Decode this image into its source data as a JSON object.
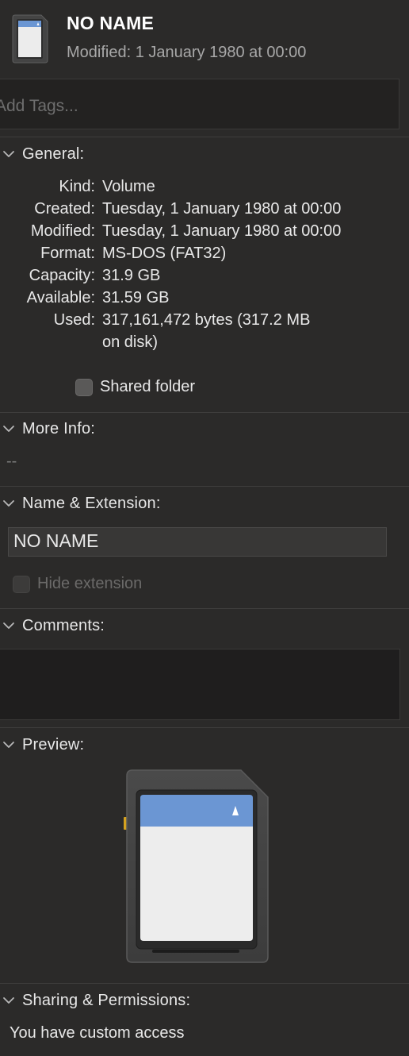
{
  "header": {
    "title": "NO NAME",
    "modified": "Modified: 1 January 1980 at 00:00"
  },
  "tags": {
    "placeholder": "Add Tags..."
  },
  "sections": {
    "general": "General:",
    "more_info": "More Info:",
    "name_extension": "Name & Extension:",
    "comments": "Comments:",
    "preview": "Preview:",
    "sharing": "Sharing & Permissions:"
  },
  "general": {
    "rows": [
      {
        "label": "Kind:",
        "value": "Volume"
      },
      {
        "label": "Created:",
        "value": "Tuesday, 1 January 1980 at 00:00"
      },
      {
        "label": "Modified:",
        "value": "Tuesday, 1 January 1980 at 00:00"
      },
      {
        "label": "Format:",
        "value": "MS-DOS (FAT32)"
      },
      {
        "label": "Capacity:",
        "value": "31.9 GB"
      },
      {
        "label": "Available:",
        "value": "31.59 GB"
      },
      {
        "label": "Used:",
        "value": "317,161,472 bytes (317.2 MB"
      }
    ],
    "used_continuation": "on disk)",
    "shared_folder_label": "Shared folder",
    "shared_folder_checked": false
  },
  "more_info": {
    "value": "--"
  },
  "name_extension": {
    "name_value": "NO NAME",
    "hide_extension_label": "Hide extension",
    "hide_extension_checked": false
  },
  "comments": {
    "value": ""
  },
  "sharing": {
    "access_text": "You have custom access"
  },
  "icons": {
    "volume": "sd-card-icon",
    "section_toggle": "chevron-down-icon"
  },
  "colors": {
    "background": "#2b2a29",
    "sd_card_label": "#6b96d3",
    "sd_card_body": "#444444",
    "contact_gold": "#d5a21f"
  }
}
